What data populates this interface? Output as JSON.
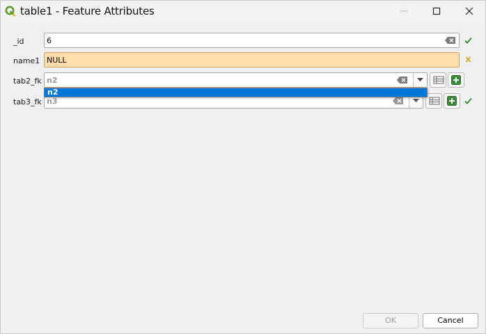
{
  "window": {
    "title": "table1 - Feature Attributes"
  },
  "colors": {
    "null_field_bg": "#ffdcab",
    "selection_bg": "#0078d7",
    "check_green": "#2e8b2e",
    "warn_orange": "#e0a000",
    "add_green": "#3a8a3a"
  },
  "fields": {
    "id": {
      "label": "_id",
      "value": "6",
      "status_icon": "check-icon"
    },
    "name1": {
      "label": "name1",
      "value": "NULL",
      "status_icon": "invalid-cross-icon"
    },
    "tab2_fk": {
      "label": "tab2_fk",
      "placeholder": "n2",
      "status_icon": "none"
    },
    "tab3_fk": {
      "label": "tab3_fk",
      "placeholder": "n3",
      "status_icon": "check-icon"
    }
  },
  "dropdown": {
    "items": [
      {
        "label": "n2",
        "selected": true
      }
    ]
  },
  "buttons": {
    "ok_label": "OK",
    "cancel_label": "Cancel"
  }
}
